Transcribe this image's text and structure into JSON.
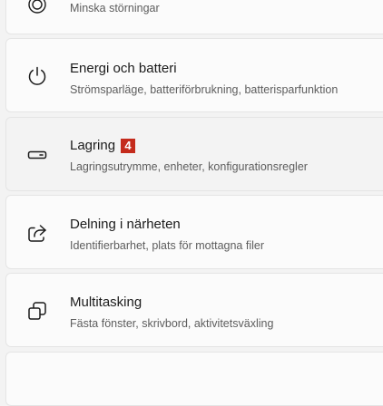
{
  "items": [
    {
      "title": "",
      "description": "Minska störningar",
      "icon": "focus-icon"
    },
    {
      "title": "Energi och batteri",
      "description": "Strömsparläge, batteriförbrukning, batterisparfunktion",
      "icon": "power-icon"
    },
    {
      "title": "Lagring",
      "badge": "4",
      "description": "Lagringsutrymme, enheter, konfigurationsregler",
      "icon": "storage-icon"
    },
    {
      "title": "Delning i närheten",
      "description": "Identifierbarhet, plats för mottagna filer",
      "icon": "share-icon"
    },
    {
      "title": "Multitasking",
      "description": "Fästa fönster, skrivbord, aktivitetsväxling",
      "icon": "multitasking-icon"
    }
  ],
  "colors": {
    "background": "#f3f3f3",
    "card": "#fbfbfb",
    "badge": "#c42b1c"
  }
}
